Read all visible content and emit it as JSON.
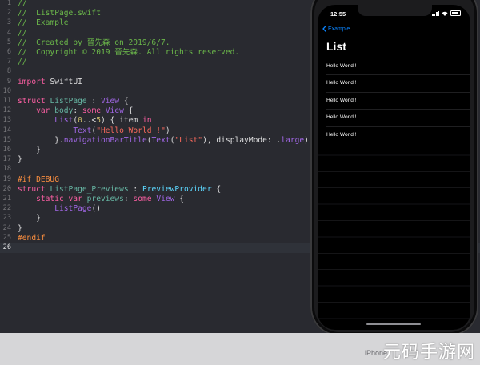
{
  "editor": {
    "lines": [
      {
        "n": "1",
        "tokens": [
          {
            "t": "//",
            "c": "c-com"
          }
        ]
      },
      {
        "n": "2",
        "tokens": [
          {
            "t": "//  ListPage.swift",
            "c": "c-com"
          }
        ]
      },
      {
        "n": "3",
        "tokens": [
          {
            "t": "//  Example",
            "c": "c-com"
          }
        ]
      },
      {
        "n": "4",
        "tokens": [
          {
            "t": "//",
            "c": "c-com"
          }
        ]
      },
      {
        "n": "5",
        "tokens": [
          {
            "t": "//  Created by 晉先森 on 2019/6/7.",
            "c": "c-com"
          }
        ]
      },
      {
        "n": "6",
        "tokens": [
          {
            "t": "//  Copyright © 2019 晉先森. All rights reserved.",
            "c": "c-com"
          }
        ]
      },
      {
        "n": "7",
        "tokens": [
          {
            "t": "//",
            "c": "c-com"
          }
        ]
      },
      {
        "n": "8",
        "tokens": []
      },
      {
        "n": "9",
        "tokens": [
          {
            "t": "import ",
            "c": "c-kw"
          },
          {
            "t": "SwiftUI",
            "c": "c-pl"
          }
        ]
      },
      {
        "n": "10",
        "tokens": []
      },
      {
        "n": "11",
        "tokens": [
          {
            "t": "struct ",
            "c": "c-kw"
          },
          {
            "t": "ListPage",
            "c": "c-fn"
          },
          {
            "t": " : ",
            "c": "c-pl"
          },
          {
            "t": "View",
            "c": "c-typ2"
          },
          {
            "t": " {",
            "c": "c-pl"
          }
        ]
      },
      {
        "n": "12",
        "tokens": [
          {
            "t": "    var ",
            "c": "c-kw"
          },
          {
            "t": "body",
            "c": "c-fn"
          },
          {
            "t": ": ",
            "c": "c-pl"
          },
          {
            "t": "some ",
            "c": "c-kw"
          },
          {
            "t": "View",
            "c": "c-typ2"
          },
          {
            "t": " {",
            "c": "c-pl"
          }
        ]
      },
      {
        "n": "13",
        "tokens": [
          {
            "t": "        ",
            "c": "c-pl"
          },
          {
            "t": "List",
            "c": "c-typ2"
          },
          {
            "t": "(",
            "c": "c-pl"
          },
          {
            "t": "0",
            "c": "c-num"
          },
          {
            "t": "..<",
            "c": "c-pl"
          },
          {
            "t": "5",
            "c": "c-num"
          },
          {
            "t": ") { item ",
            "c": "c-pl"
          },
          {
            "t": "in",
            "c": "c-kw"
          }
        ]
      },
      {
        "n": "14",
        "tokens": [
          {
            "t": "            ",
            "c": "c-pl"
          },
          {
            "t": "Text",
            "c": "c-typ2"
          },
          {
            "t": "(",
            "c": "c-pl"
          },
          {
            "t": "\"Hello World !\"",
            "c": "c-str"
          },
          {
            "t": ")",
            "c": "c-pl"
          }
        ]
      },
      {
        "n": "15",
        "tokens": [
          {
            "t": "        }.",
            "c": "c-pl"
          },
          {
            "t": "navigationBarTitle",
            "c": "c-typ2"
          },
          {
            "t": "(",
            "c": "c-pl"
          },
          {
            "t": "Text",
            "c": "c-typ2"
          },
          {
            "t": "(",
            "c": "c-pl"
          },
          {
            "t": "\"List\"",
            "c": "c-str"
          },
          {
            "t": "), displayMode: .",
            "c": "c-pl"
          },
          {
            "t": "large",
            "c": "c-typ2"
          },
          {
            "t": ")",
            "c": "c-pl"
          }
        ]
      },
      {
        "n": "16",
        "tokens": [
          {
            "t": "    }",
            "c": "c-pl"
          }
        ]
      },
      {
        "n": "17",
        "tokens": [
          {
            "t": "}",
            "c": "c-pl"
          }
        ]
      },
      {
        "n": "18",
        "tokens": []
      },
      {
        "n": "19",
        "tokens": [
          {
            "t": "#if DEBUG",
            "c": "c-pre"
          }
        ]
      },
      {
        "n": "20",
        "tokens": [
          {
            "t": "struct ",
            "c": "c-kw"
          },
          {
            "t": "ListPage_Previews",
            "c": "c-fn"
          },
          {
            "t": " : ",
            "c": "c-pl"
          },
          {
            "t": "PreviewProvider",
            "c": "c-typ"
          },
          {
            "t": " {",
            "c": "c-pl"
          }
        ]
      },
      {
        "n": "21",
        "tokens": [
          {
            "t": "    static var ",
            "c": "c-kw"
          },
          {
            "t": "previews",
            "c": "c-fn"
          },
          {
            "t": ": ",
            "c": "c-pl"
          },
          {
            "t": "some ",
            "c": "c-kw"
          },
          {
            "t": "View",
            "c": "c-typ2"
          },
          {
            "t": " {",
            "c": "c-pl"
          }
        ]
      },
      {
        "n": "22",
        "tokens": [
          {
            "t": "        ",
            "c": "c-pl"
          },
          {
            "t": "ListPage",
            "c": "c-typ2"
          },
          {
            "t": "()",
            "c": "c-pl"
          }
        ]
      },
      {
        "n": "23",
        "tokens": [
          {
            "t": "    }",
            "c": "c-pl"
          }
        ]
      },
      {
        "n": "24",
        "tokens": [
          {
            "t": "}",
            "c": "c-pl"
          }
        ]
      },
      {
        "n": "25",
        "tokens": [
          {
            "t": "#endif",
            "c": "c-pre"
          }
        ]
      },
      {
        "n": "26",
        "tokens": [],
        "current": true
      }
    ]
  },
  "preview": {
    "status_time": "12:55",
    "back_label": "Example",
    "nav_title": "List",
    "rows": [
      "Hello World !",
      "Hello World !",
      "Hello World !",
      "Hello World !",
      "Hello World !"
    ]
  },
  "bottom_bar": {
    "device_label": "iPhone",
    "watermark": "元码手游网"
  }
}
